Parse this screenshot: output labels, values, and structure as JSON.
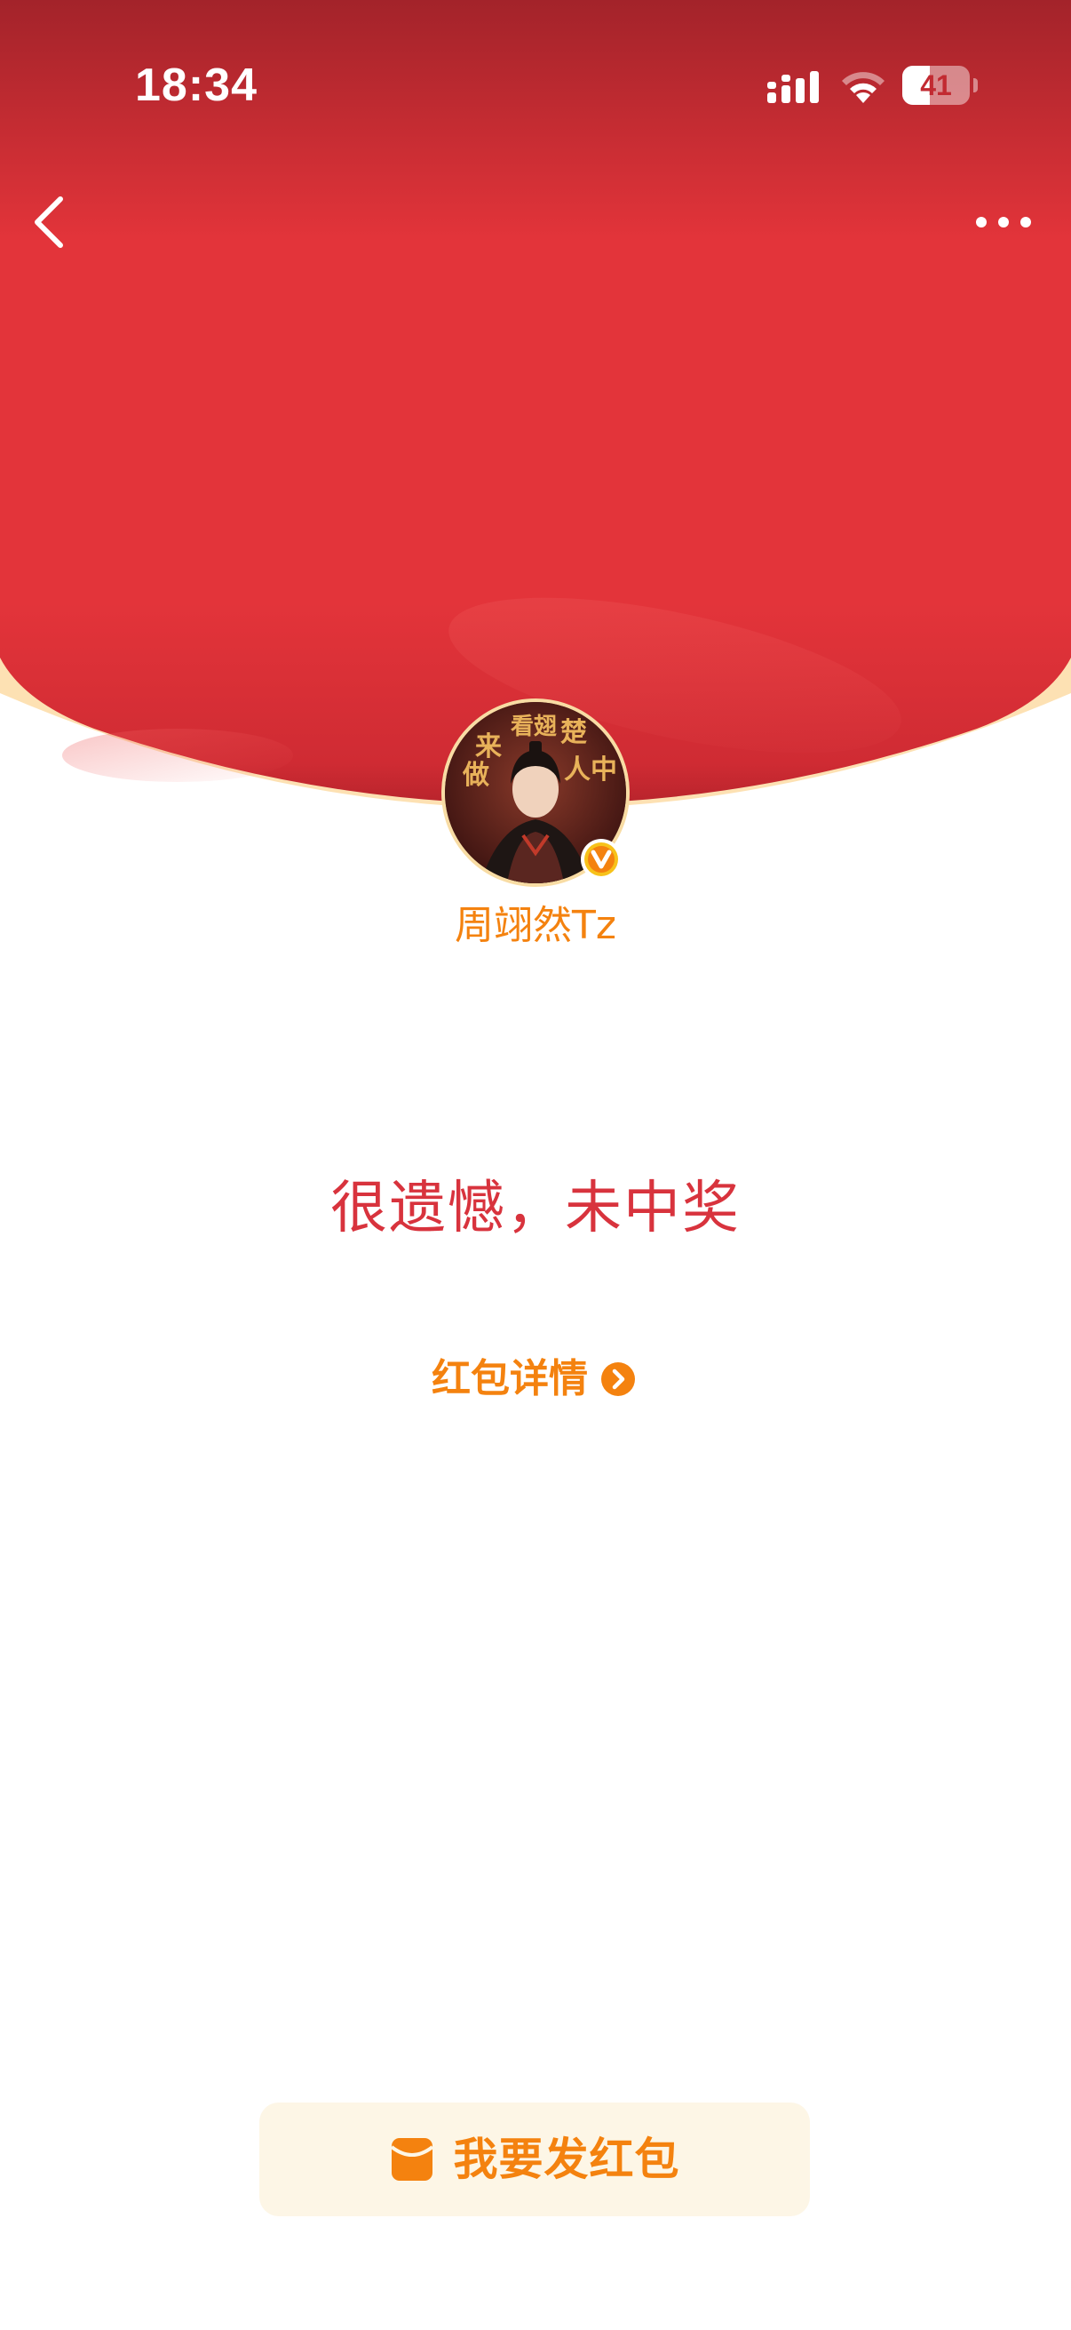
{
  "status_bar": {
    "time": "18:34",
    "battery_level": "41",
    "battery_fraction": 0.41,
    "signal_icon": "cellular-signal-icon",
    "wifi_icon": "wifi-icon"
  },
  "nav": {
    "back_icon": "chevron-left-icon",
    "more_icon": "more-horizontal-icon"
  },
  "sender": {
    "name": "周翊然Tz",
    "avatar": "avatar-photo",
    "verified_icon": "verified-v-badge-icon",
    "avatar_calligraphy": "来看翅楚人中做"
  },
  "result": {
    "message": "很遗憾，未中奖"
  },
  "details": {
    "label": "红包详情",
    "icon": "chevron-right-circle-icon"
  },
  "send_button": {
    "label": "我要发红包",
    "icon": "red-envelope-icon"
  },
  "colors": {
    "header_red": "#e3343a",
    "header_dark_red": "#a3232a",
    "accent_orange": "#f4820f",
    "result_red": "#d8333d",
    "arc_cream": "#fde1b3",
    "button_bg": "#fdf6e6"
  }
}
